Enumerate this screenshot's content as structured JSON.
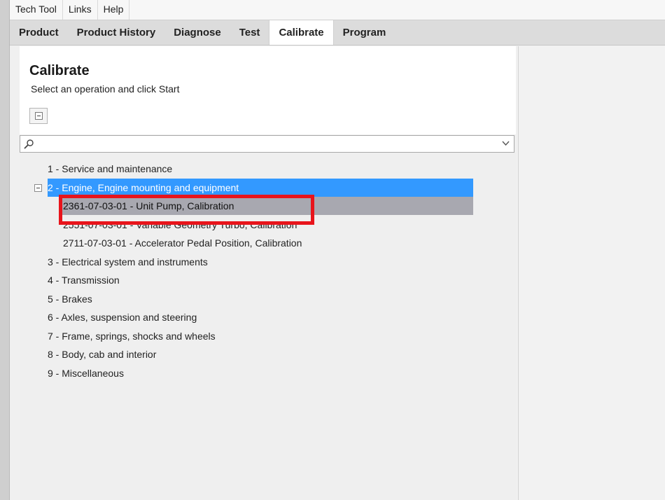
{
  "menu": {
    "items": [
      {
        "label": "Tech Tool"
      },
      {
        "label": "Links"
      },
      {
        "label": "Help"
      }
    ]
  },
  "tabs": [
    {
      "label": "Product"
    },
    {
      "label": "Product History"
    },
    {
      "label": "Diagnose"
    },
    {
      "label": "Test"
    },
    {
      "label": "Calibrate",
      "active": true
    },
    {
      "label": "Program"
    }
  ],
  "page": {
    "title": "Calibrate",
    "subtitle": "Select an operation and click Start"
  },
  "search": {
    "value": "",
    "placeholder": ""
  },
  "tree": {
    "groups": [
      {
        "label": "1 - Service and maintenance"
      },
      {
        "label": "2 - Engine, Engine mounting and equipment",
        "expanded": true,
        "selected": true,
        "children": [
          {
            "label": "2361-07-03-01 - Unit Pump, Calibration",
            "hovered": true
          },
          {
            "label": "2551-07-03-01 - Variable Geometry Turbo, Calibration"
          },
          {
            "label": "2711-07-03-01 - Accelerator Pedal Position, Calibration"
          }
        ]
      },
      {
        "label": "3 - Electrical system and instruments"
      },
      {
        "label": "4 - Transmission"
      },
      {
        "label": "5 - Brakes"
      },
      {
        "label": "6 - Axles, suspension and steering"
      },
      {
        "label": "7 - Frame, springs, shocks and wheels"
      },
      {
        "label": "8 - Body, cab and interior"
      },
      {
        "label": "9 - Miscellaneous"
      }
    ]
  },
  "colors": {
    "selection": "#3399ff",
    "hover": "#a8a8b0",
    "annotation": "#e8141b"
  },
  "icons": {
    "collapse_all": "minus-box-icon",
    "expander": "minus-box-icon",
    "search": "magnifier-icon",
    "dropdown": "chevron-down-icon"
  }
}
